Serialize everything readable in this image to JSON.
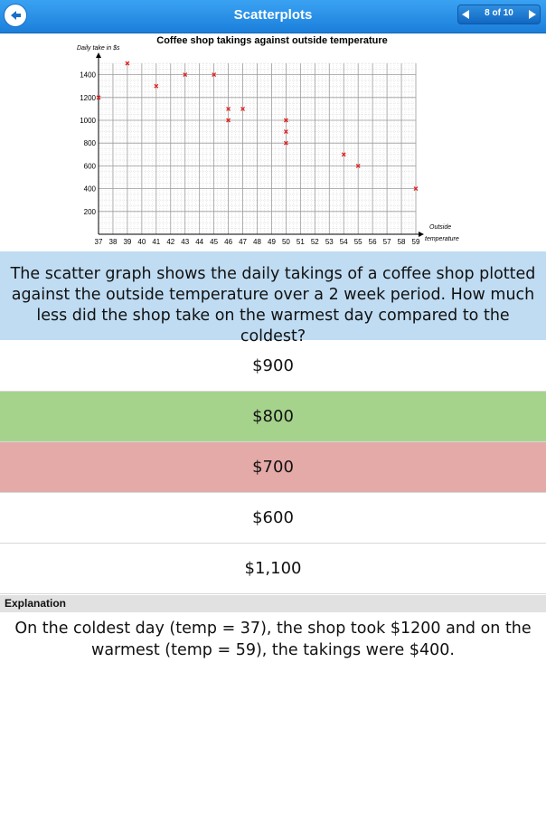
{
  "header": {
    "title": "Scatterplots",
    "back_icon": "back-arrow-icon",
    "pager": {
      "label": "8 of 10",
      "prev_icon": "triangle-left-icon",
      "next_icon": "triangle-right-icon"
    }
  },
  "chart_data": {
    "type": "scatter",
    "title": "Coffee shop takings against outside temperature",
    "ylabel": "Daily take in $s",
    "xlabel_lines": [
      "Outside",
      "temperature"
    ],
    "x_ticks": [
      37,
      38,
      39,
      40,
      41,
      42,
      43,
      44,
      45,
      46,
      47,
      48,
      49,
      50,
      51,
      52,
      53,
      54,
      55,
      56,
      57,
      58,
      59
    ],
    "y_ticks": [
      200,
      400,
      600,
      800,
      1000,
      1200,
      1400
    ],
    "xlim": [
      37,
      59
    ],
    "ylim": [
      0,
      1500
    ],
    "grid": true,
    "marker_color": "#e02020",
    "points": [
      {
        "x": 37,
        "y": 1200
      },
      {
        "x": 39,
        "y": 1500
      },
      {
        "x": 41,
        "y": 1300
      },
      {
        "x": 43,
        "y": 1400
      },
      {
        "x": 45,
        "y": 1400
      },
      {
        "x": 46,
        "y": 1100
      },
      {
        "x": 46,
        "y": 1000
      },
      {
        "x": 47,
        "y": 1100
      },
      {
        "x": 50,
        "y": 1000
      },
      {
        "x": 50,
        "y": 900
      },
      {
        "x": 50,
        "y": 800
      },
      {
        "x": 54,
        "y": 700
      },
      {
        "x": 55,
        "y": 600
      },
      {
        "x": 59,
        "y": 400
      }
    ]
  },
  "question": "The scatter graph shows the  daily takings of a coffee shop plotted against the outside temperature over a 2 week period. How much less did the shop take on the warmest day compared to the coldest?",
  "options": [
    {
      "label": "$900",
      "state": "default"
    },
    {
      "label": "$800",
      "state": "correct"
    },
    {
      "label": "$700",
      "state": "wrong"
    },
    {
      "label": "$600",
      "state": "default"
    },
    {
      "label": "$1,100",
      "state": "default"
    }
  ],
  "colors": {
    "correct": "#a6d38c",
    "wrong": "#e4aaa8",
    "header": "#2a8fe6",
    "question_bg": "#bfdcf2"
  },
  "explanation": {
    "heading": "Explanation",
    "text": "On the coldest day (temp = 37), the shop took $1200 and on the warmest (temp = 59), the takings were $400."
  }
}
